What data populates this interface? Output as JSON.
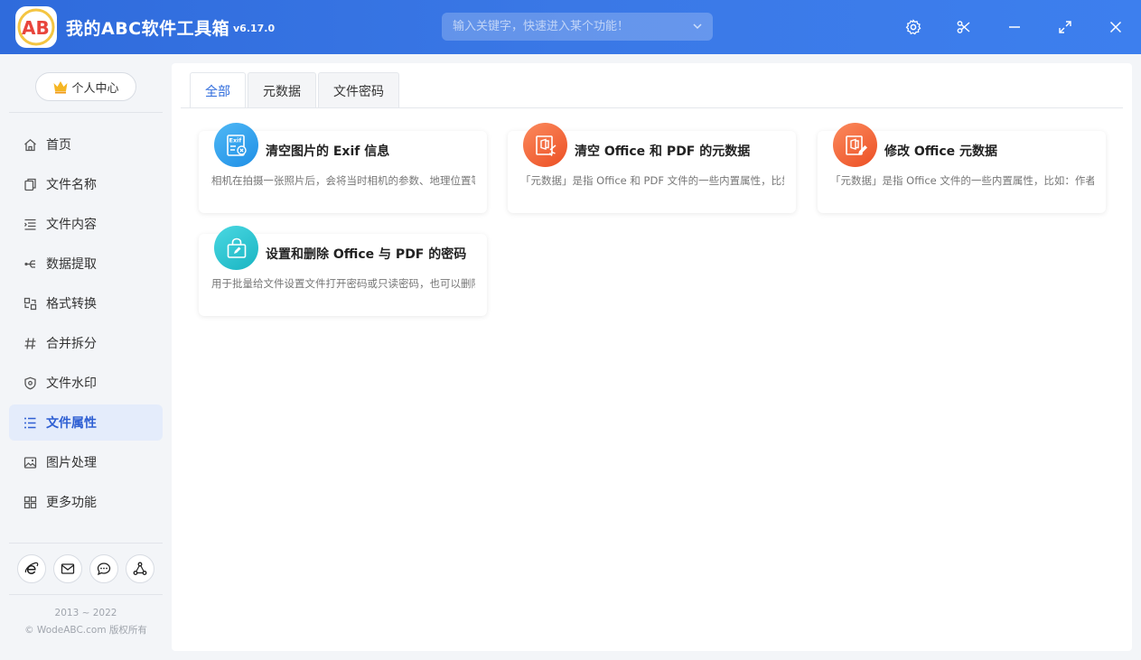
{
  "app": {
    "title": "我的ABC软件工具箱",
    "version": "v6.17.0",
    "logo_text": "AB",
    "search_placeholder": "输入关键字，快速进入某个功能！"
  },
  "colors": {
    "brand_blue": "#3a78e6",
    "active_nav_text": "#2e5fd3",
    "active_tab_text": "#2e6bdc"
  },
  "sidebar": {
    "user_center": "个人中心",
    "items": [
      {
        "label": "首页",
        "icon": "home-icon"
      },
      {
        "label": "文件名称",
        "icon": "file-copy-icon"
      },
      {
        "label": "文件内容",
        "icon": "text-list-icon"
      },
      {
        "label": "数据提取",
        "icon": "extract-icon"
      },
      {
        "label": "格式转换",
        "icon": "convert-icon"
      },
      {
        "label": "合并拆分",
        "icon": "hash-icon"
      },
      {
        "label": "文件水印",
        "icon": "shield-icon"
      },
      {
        "label": "文件属性",
        "icon": "list-icon",
        "active": true
      },
      {
        "label": "图片处理",
        "icon": "image-icon"
      },
      {
        "label": "更多功能",
        "icon": "grid-icon"
      }
    ],
    "footer_icons": [
      "ie-browser-icon",
      "mail-icon",
      "chat-icon",
      "share-icon"
    ],
    "copyright_years": "2013 ~ 2022",
    "copyright_owner": "© WodeABC.com 版权所有"
  },
  "tabs": [
    {
      "label": "全部",
      "active": true
    },
    {
      "label": "元数据"
    },
    {
      "label": "文件密码"
    }
  ],
  "cards": [
    {
      "title": "清空图片的 Exif 信息",
      "desc": "相机在拍摄一张照片后，会将当时相机的参数、地理位置等信息",
      "icon": "exif-icon",
      "icon_badge": "Exif"
    },
    {
      "title": "清空 Office 和 PDF 的元数据",
      "desc": "「元数据」是指 Office 和 PDF 文件的一些内置属性，比如作者",
      "icon": "office-clean-icon"
    },
    {
      "title": "修改 Office 元数据",
      "desc": "「元数据」是指 Office 文件的一些内置属性，比如：作者、标题",
      "icon": "office-edit-icon"
    },
    {
      "title": "设置和删除 Office 与 PDF 的密码",
      "desc": "用于批量给文件设置文件打开密码或只读密码，也可以删除密码",
      "icon": "lock-bag-icon"
    }
  ]
}
